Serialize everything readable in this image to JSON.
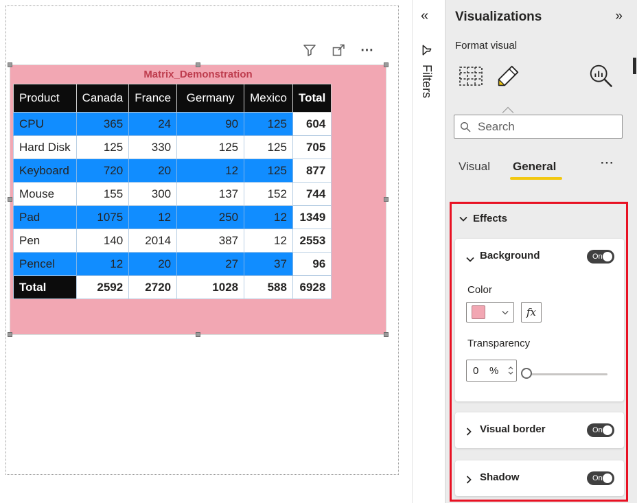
{
  "colors": {
    "pink": "#F2A7B3",
    "row_blue": "#118DFF",
    "tab_yellow": "#F2C811",
    "highlight_red": "#E81123",
    "title_red": "#BE3D4E"
  },
  "canvas": {
    "toolbar": {
      "more": "⋯"
    },
    "visual": {
      "title": "Matrix_Demonstration",
      "table": {
        "columns": [
          "Product",
          "Canada",
          "France",
          "Germany",
          "Mexico",
          "Total"
        ],
        "rows": [
          [
            "CPU",
            "365",
            "24",
            "90",
            "125",
            "604"
          ],
          [
            "Hard Disk",
            "125",
            "330",
            "125",
            "125",
            "705"
          ],
          [
            "Keyboard",
            "720",
            "20",
            "12",
            "125",
            "877"
          ],
          [
            "Mouse",
            "155",
            "300",
            "137",
            "152",
            "744"
          ],
          [
            "Pad",
            "1075",
            "12",
            "250",
            "12",
            "1349"
          ],
          [
            "Pen",
            "140",
            "2014",
            "387",
            "12",
            "2553"
          ],
          [
            "Pencel",
            "12",
            "20",
            "27",
            "37",
            "96"
          ]
        ],
        "total_row": [
          "Total",
          "2592",
          "2720",
          "1028",
          "588",
          "6928"
        ]
      }
    }
  },
  "filters_pane": {
    "expand_icon": "«",
    "label": "Filters"
  },
  "viz_pane": {
    "title": "Visualizations",
    "collapse_icon": "»",
    "subtitle": "Format visual",
    "search": {
      "placeholder": "Search"
    },
    "tabs": {
      "visual": "Visual",
      "general": "General",
      "more": "···"
    },
    "effects": {
      "header": "Effects",
      "background": {
        "label": "Background",
        "toggle": "On",
        "color_label": "Color",
        "fx": "fx",
        "transparency_label": "Transparency",
        "value": "0",
        "unit": "%"
      },
      "visual_border": {
        "label": "Visual border",
        "toggle": "On"
      },
      "shadow": {
        "label": "Shadow",
        "toggle": "On"
      }
    }
  }
}
